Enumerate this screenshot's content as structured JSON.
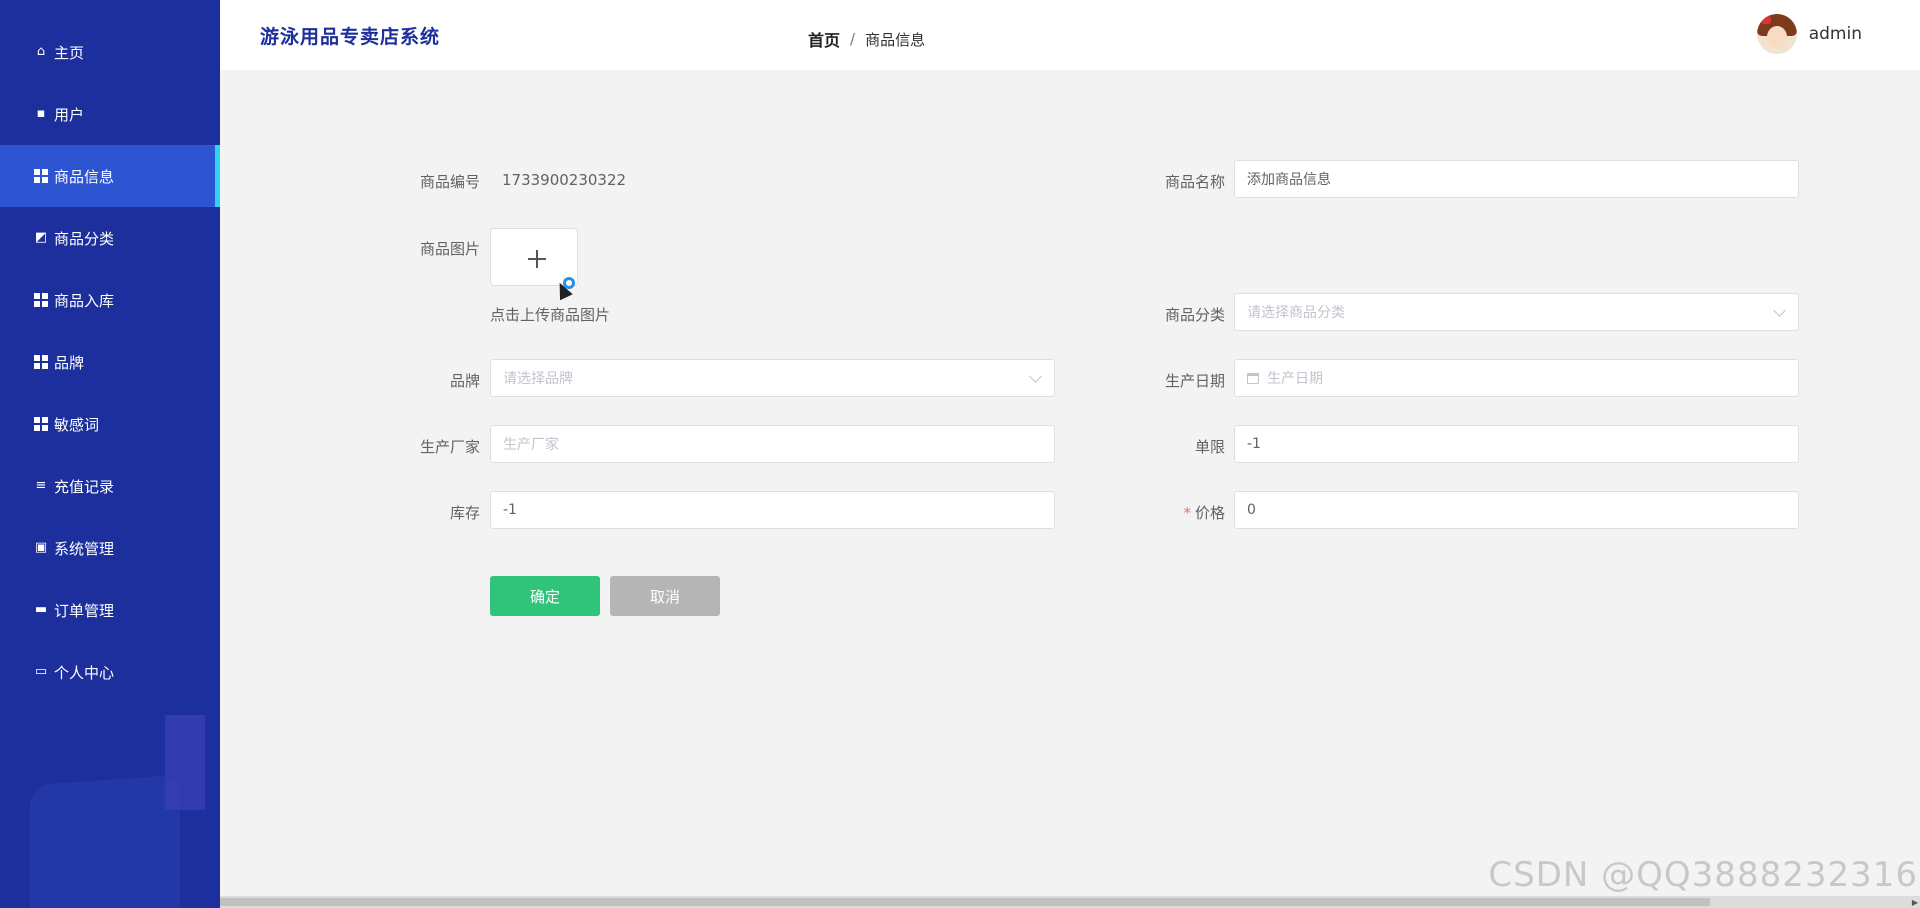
{
  "sidebar": {
    "items": [
      {
        "label": "主页",
        "icon": "home-icon"
      },
      {
        "label": "用户",
        "icon": "chat-icon"
      },
      {
        "label": "商品信息",
        "icon": "grid-icon",
        "active": true
      },
      {
        "label": "商品分类",
        "icon": "chart-icon"
      },
      {
        "label": "商品入库",
        "icon": "grid-icon"
      },
      {
        "label": "品牌",
        "icon": "grid-icon"
      },
      {
        "label": "敏感词",
        "icon": "grid-icon"
      },
      {
        "label": "充值记录",
        "icon": "sliders-icon"
      },
      {
        "label": "系统管理",
        "icon": "clipboard-icon"
      },
      {
        "label": "订单管理",
        "icon": "monitor-icon"
      },
      {
        "label": "个人中心",
        "icon": "card-icon"
      }
    ]
  },
  "header": {
    "title": "游泳用品专卖店系统",
    "breadcrumb": {
      "home": "首页",
      "separator": "/",
      "current": "商品信息"
    },
    "user": "admin"
  },
  "form": {
    "product_no": {
      "label": "商品编号",
      "value": "1733900230322"
    },
    "product_name": {
      "label": "商品名称",
      "value": "添加商品信息"
    },
    "product_image": {
      "label": "商品图片",
      "hint": "点击上传商品图片"
    },
    "category": {
      "label": "商品分类",
      "placeholder": "请选择商品分类"
    },
    "brand": {
      "label": "品牌",
      "placeholder": "请选择品牌"
    },
    "production_date": {
      "label": "生产日期",
      "placeholder": "生产日期"
    },
    "manufacturer": {
      "label": "生产厂家",
      "placeholder": "生产厂家"
    },
    "limit": {
      "label": "单限",
      "value": "-1"
    },
    "stock": {
      "label": "库存",
      "value": "-1"
    },
    "price": {
      "label": "价格",
      "value": "0",
      "required_mark": "*"
    },
    "confirm_label": "确定",
    "cancel_label": "取消"
  },
  "watermark": "CSDN @QQ3888232316",
  "colors": {
    "sidebar": "#1c2f9c",
    "active": "#2d55d1",
    "accent": "#2ed6f2",
    "confirm": "#2fc47a",
    "cancel": "#b5b5b5"
  }
}
